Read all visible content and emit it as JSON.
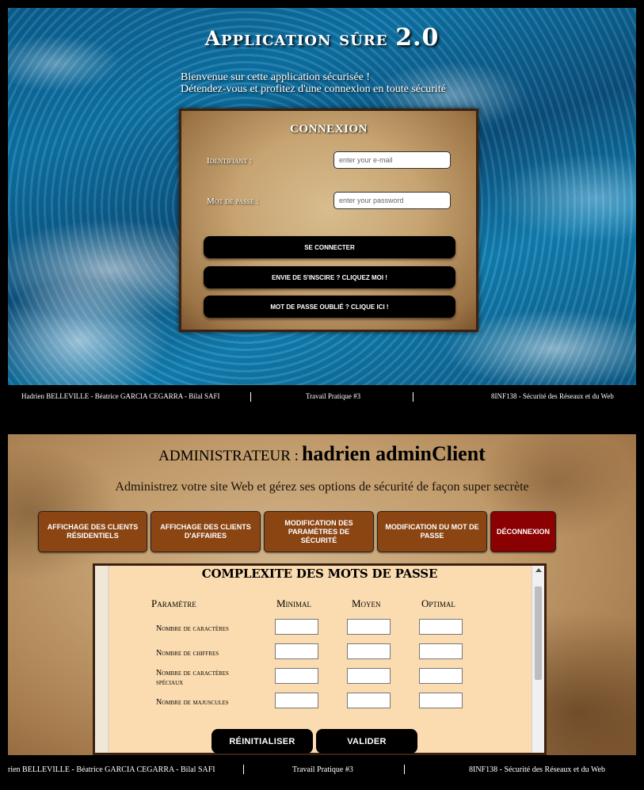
{
  "login": {
    "title_main": "Application sûre",
    "title_version": "2.0",
    "welcome_line1": "Bienvenue sur cette application sécurisée !",
    "welcome_line2": "Détendez-vous et profitez d'une connexion en toute sécurité",
    "card_title": "CONNEXION",
    "identifier_label": "Identifiant :",
    "identifier_placeholder": "enter your e-mail",
    "password_label": "Mot de passe :",
    "password_placeholder": "enter your password",
    "connect_button": "Se connecter",
    "register_button": "Envie de s'inscire ? Cliquez moi !",
    "forgot_button": "Mot de passe oublié ? Clique ici !"
  },
  "footer_top": {
    "authors": "Hadrien BELLEVILLE - Béatrice GARCIA CEGARRA - Bilal SAFI",
    "assignment": "Travail Pratique #3",
    "course": "8INF138 - Sécurité des Réseaux et du Web"
  },
  "admin": {
    "role_label": "ADMINISTRATEUR :",
    "username": "hadrien adminClient",
    "subtitle": "Administrez votre site Web et gérez ses options de sécurité de façon super secrète",
    "nav": [
      "Affichage des clients résidentiels",
      "Affichage des clients d'affaires",
      "Modification des paramètres de sécurité",
      "Modification du mot de passe",
      "Déconnexion"
    ],
    "panel_title": "COMPLEXITE DES MOTS DE PASSE",
    "columns": [
      "Paramètre",
      "Minimal",
      "Moyen",
      "Optimal"
    ],
    "rows": [
      "Nombre de caractères",
      "Nombre de chiffres",
      "Nombre de caractères spéciaux",
      "Nombre de majuscules"
    ],
    "reset_button": "Réinitialiser",
    "submit_button": "Valider"
  },
  "footer_bottom": {
    "authors": "rien BELLEVILLE - Béatrice GARCIA CEGARRA - Bilal SAFI",
    "assignment": "Travail Pratique #3",
    "course": "8INF138 - Sécurité des Réseaux et du Web"
  },
  "colors": {
    "nav_button": "#8b4513",
    "logout_button": "#8b0000",
    "panel_background": "#fbdcb0"
  }
}
